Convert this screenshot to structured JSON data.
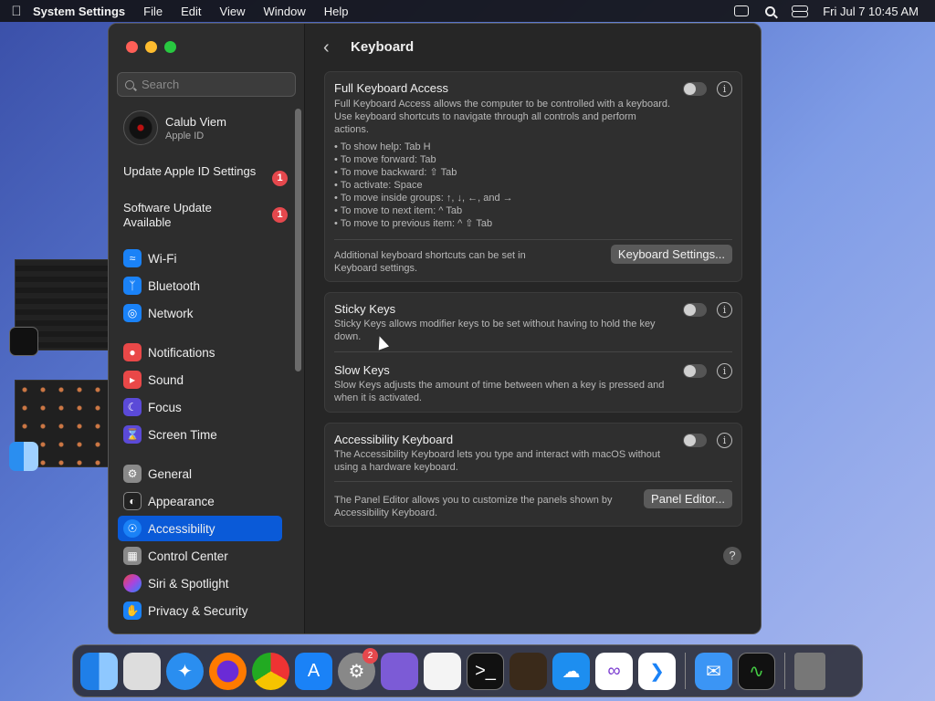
{
  "menubar": {
    "app_name": "System Settings",
    "items": [
      "File",
      "Edit",
      "View",
      "Window",
      "Help"
    ],
    "datetime": "Fri Jul 7  10:45 AM"
  },
  "sidebar": {
    "search_placeholder": "Search",
    "user": {
      "name": "Calub Viem",
      "subtitle": "Apple ID"
    },
    "notices": [
      {
        "label": "Update Apple ID Settings",
        "badge": "1"
      },
      {
        "label": "Software Update Available",
        "badge": "1"
      }
    ],
    "items": [
      {
        "label": "Wi-Fi",
        "icon": "wifi-icon",
        "color": "#1a82f7"
      },
      {
        "label": "Bluetooth",
        "icon": "bluetooth-icon",
        "color": "#1a82f7"
      },
      {
        "label": "Network",
        "icon": "globe-icon",
        "color": "#1a82f7"
      },
      {
        "label": "Notifications",
        "icon": "bell-icon",
        "color": "#e94848"
      },
      {
        "label": "Sound",
        "icon": "speaker-icon",
        "color": "#e94848"
      },
      {
        "label": "Focus",
        "icon": "moon-icon",
        "color": "#5b4ad8"
      },
      {
        "label": "Screen Time",
        "icon": "hourglass-icon",
        "color": "#5b4ad8"
      },
      {
        "label": "General",
        "icon": "gear-icon",
        "color": "#8a8a8a"
      },
      {
        "label": "Appearance",
        "icon": "appearance-icon",
        "color": "#222222"
      },
      {
        "label": "Accessibility",
        "icon": "accessibility-icon",
        "color": "#1a82f7"
      },
      {
        "label": "Control Center",
        "icon": "control-center-icon",
        "color": "#8a8a8a"
      },
      {
        "label": "Siri & Spotlight",
        "icon": "siri-icon",
        "color": "#b04ad8"
      },
      {
        "label": "Privacy & Security",
        "icon": "hand-icon",
        "color": "#1a82f7"
      }
    ],
    "active_item": "Accessibility"
  },
  "main": {
    "title": "Keyboard",
    "full_keyboard_access": {
      "title": "Full Keyboard Access",
      "description": "Full Keyboard Access allows the computer to be controlled with a keyboard. Use keyboard shortcuts to navigate through all controls and perform actions.",
      "shortcuts": [
        "• To show help: Tab H",
        "• To move forward: Tab",
        "• To move backward: ⇧ Tab",
        "• To activate: Space",
        "• To move inside groups: ↑, ↓, ←, and →",
        "• To move to next item: ^ Tab",
        "• To move to previous item: ^ ⇧ Tab"
      ],
      "footer": "Additional keyboard shortcuts can be set in Keyboard settings.",
      "button": "Keyboard Settings...",
      "enabled": false
    },
    "sticky_keys": {
      "title": "Sticky Keys",
      "description": "Sticky Keys allows modifier keys to be set without having to hold the key down.",
      "enabled": false
    },
    "slow_keys": {
      "title": "Slow Keys",
      "description": "Slow Keys adjusts the amount of time between when a key is pressed and when it is activated.",
      "enabled": false
    },
    "accessibility_keyboard": {
      "title": "Accessibility Keyboard",
      "description": "The Accessibility Keyboard lets you type and interact with macOS without using a hardware keyboard.",
      "footer": "The Panel Editor allows you to customize the panels shown by Accessibility Keyboard.",
      "button": "Panel Editor...",
      "enabled": false
    },
    "info_glyph": "i",
    "help_glyph": "?"
  },
  "dock": {
    "settings_badge": "2"
  }
}
